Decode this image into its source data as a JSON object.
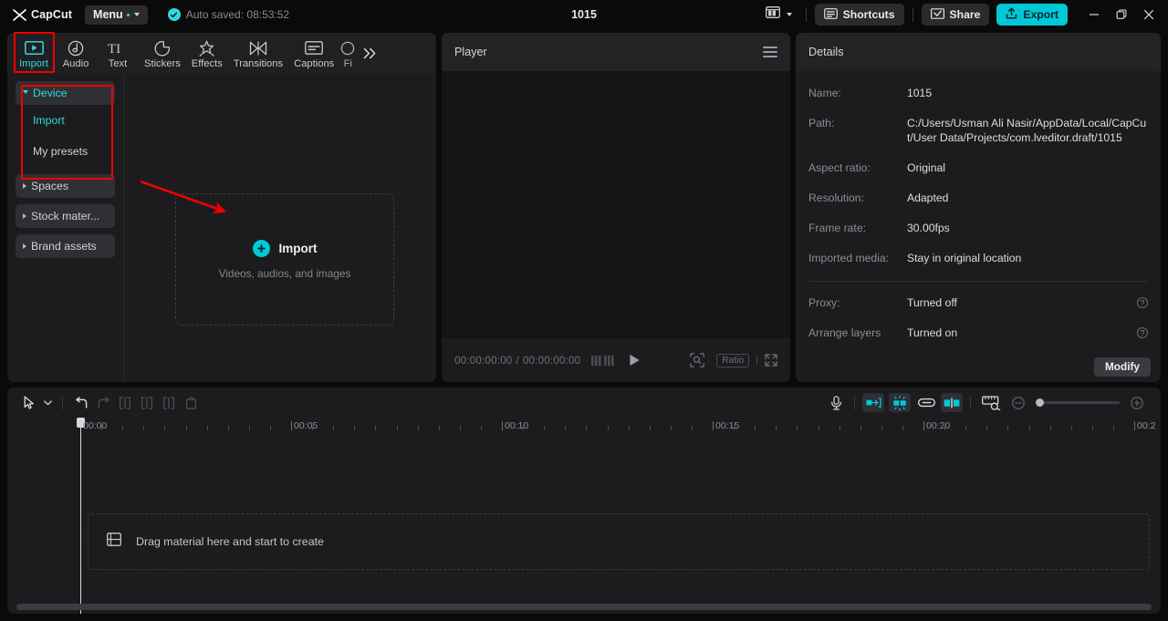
{
  "titlebar": {
    "brand": "CapCut",
    "menu_label": "Menu",
    "autosave_text": "Auto saved: 08:53:52",
    "project_title": "1015",
    "shortcuts_label": "Shortcuts",
    "share_label": "Share",
    "export_label": "Export",
    "layout_icon": "layout-grid-icon",
    "minimize_icon": "minimize-icon",
    "maximize_icon": "maximize-icon",
    "close_icon": "close-icon"
  },
  "toolbar": {
    "tabs": [
      {
        "label": "Import",
        "icon": "import-video-icon",
        "active": true
      },
      {
        "label": "Audio",
        "icon": "audio-note-icon",
        "active": false
      },
      {
        "label": "Text",
        "icon": "text-ti-icon",
        "active": false
      },
      {
        "label": "Stickers",
        "icon": "sticker-icon",
        "active": false
      },
      {
        "label": "Effects",
        "icon": "sparkle-effects-icon",
        "active": false
      },
      {
        "label": "Transitions",
        "icon": "transitions-bowtie-icon",
        "active": false
      },
      {
        "label": "Captions",
        "icon": "captions-icon",
        "active": false
      },
      {
        "label": "Fi",
        "icon": "filters-icon",
        "active": false
      }
    ],
    "more_icon": "chevron-double-right-icon"
  },
  "sidebar": {
    "items": [
      {
        "label": "Device",
        "type": "group",
        "expanded": true,
        "active": true
      },
      {
        "label": "Import",
        "type": "sub",
        "active": true
      },
      {
        "label": "My presets",
        "type": "sub",
        "active": false
      },
      {
        "label": "Spaces",
        "type": "group",
        "expanded": false,
        "active": false
      },
      {
        "label": "Stock mater...",
        "type": "group",
        "expanded": false,
        "active": false
      },
      {
        "label": "Brand assets",
        "type": "group",
        "expanded": false,
        "active": false
      }
    ]
  },
  "media": {
    "dropzone_title": "Import",
    "dropzone_subtitle": "Videos, audios, and images",
    "plus_icon": "plus-circle-icon"
  },
  "player": {
    "title": "Player",
    "menu_icon": "hamburger-menu-icon",
    "current_time": "00:00:00:00",
    "time_separator": "/",
    "total_time": "00:00:00:00",
    "frame_back_icon": "frame-step-back-icon",
    "frame_fwd_icon": "frame-step-forward-icon",
    "play_icon": "play-icon",
    "zoom_icon": "magnify-frame-icon",
    "ratio_label": "Ratio",
    "fullscreen_icon": "fullscreen-icon"
  },
  "details": {
    "title": "Details",
    "rows": [
      {
        "label": "Name:",
        "value": "1015"
      },
      {
        "label": "Path:",
        "value": "C:/Users/Usman Ali Nasir/AppData/Local/CapCut/User Data/Projects/com.lveditor.draft/1015"
      },
      {
        "label": "Aspect ratio:",
        "value": "Original"
      },
      {
        "label": "Resolution:",
        "value": "Adapted"
      },
      {
        "label": "Frame rate:",
        "value": "30.00fps"
      },
      {
        "label": "Imported media:",
        "value": "Stay in original location"
      }
    ],
    "toggles": [
      {
        "label": "Proxy:",
        "value": "Turned off",
        "help_icon": "help-circle-icon"
      },
      {
        "label": "Arrange layers",
        "value": "Turned on",
        "help_icon": "help-circle-icon"
      }
    ],
    "modify_label": "Modify"
  },
  "timeline": {
    "tools": [
      {
        "name": "select-cursor-tool",
        "icon": "cursor-arrow-icon",
        "enabled": true
      },
      {
        "name": "cursor-dropdown",
        "icon": "chevron-down-icon",
        "enabled": true
      },
      {
        "name": "undo-button",
        "icon": "undo-icon",
        "enabled": true
      },
      {
        "name": "redo-button",
        "icon": "redo-icon",
        "enabled": false
      },
      {
        "name": "split-button",
        "icon": "split-icon",
        "enabled": false
      },
      {
        "name": "trim-left-button",
        "icon": "trim-left-icon",
        "enabled": false
      },
      {
        "name": "trim-right-button",
        "icon": "trim-right-icon",
        "enabled": false
      },
      {
        "name": "delete-button",
        "icon": "trash-icon",
        "enabled": false
      }
    ],
    "right_tools": [
      {
        "name": "record-voiceover-button",
        "icon": "microphone-icon",
        "active": false
      },
      {
        "name": "auto-snap-button",
        "icon": "snap-to-start-icon",
        "active": true
      },
      {
        "name": "magnetic-snap-button",
        "icon": "magnetic-snap-icon",
        "active": true
      },
      {
        "name": "link-clips-button",
        "icon": "link-icon",
        "active": false
      },
      {
        "name": "adjust-clip-button",
        "icon": "clip-mirror-icon",
        "active": true
      },
      {
        "name": "preview-thumbnails-button",
        "icon": "filmstrip-ruler-icon",
        "active": false
      }
    ],
    "zoom_out_icon": "zoom-out-icon",
    "zoom_in_icon": "zoom-in-icon",
    "ruler_labels": [
      "00:00",
      "00:05",
      "00:10",
      "00:15",
      "00:20",
      "00:2"
    ],
    "drop_hint": "Drag material here and start to create",
    "drop_hint_icon": "filmstrip-icon",
    "playhead_position": "00:00"
  },
  "colors": {
    "accent": "#00c8d7",
    "accent_text": "#2fd8e0",
    "annotation_red": "#f10000",
    "panel_bg": "#1c1c1f",
    "header_bg": "#232326",
    "app_bg": "#0a0a0a"
  }
}
